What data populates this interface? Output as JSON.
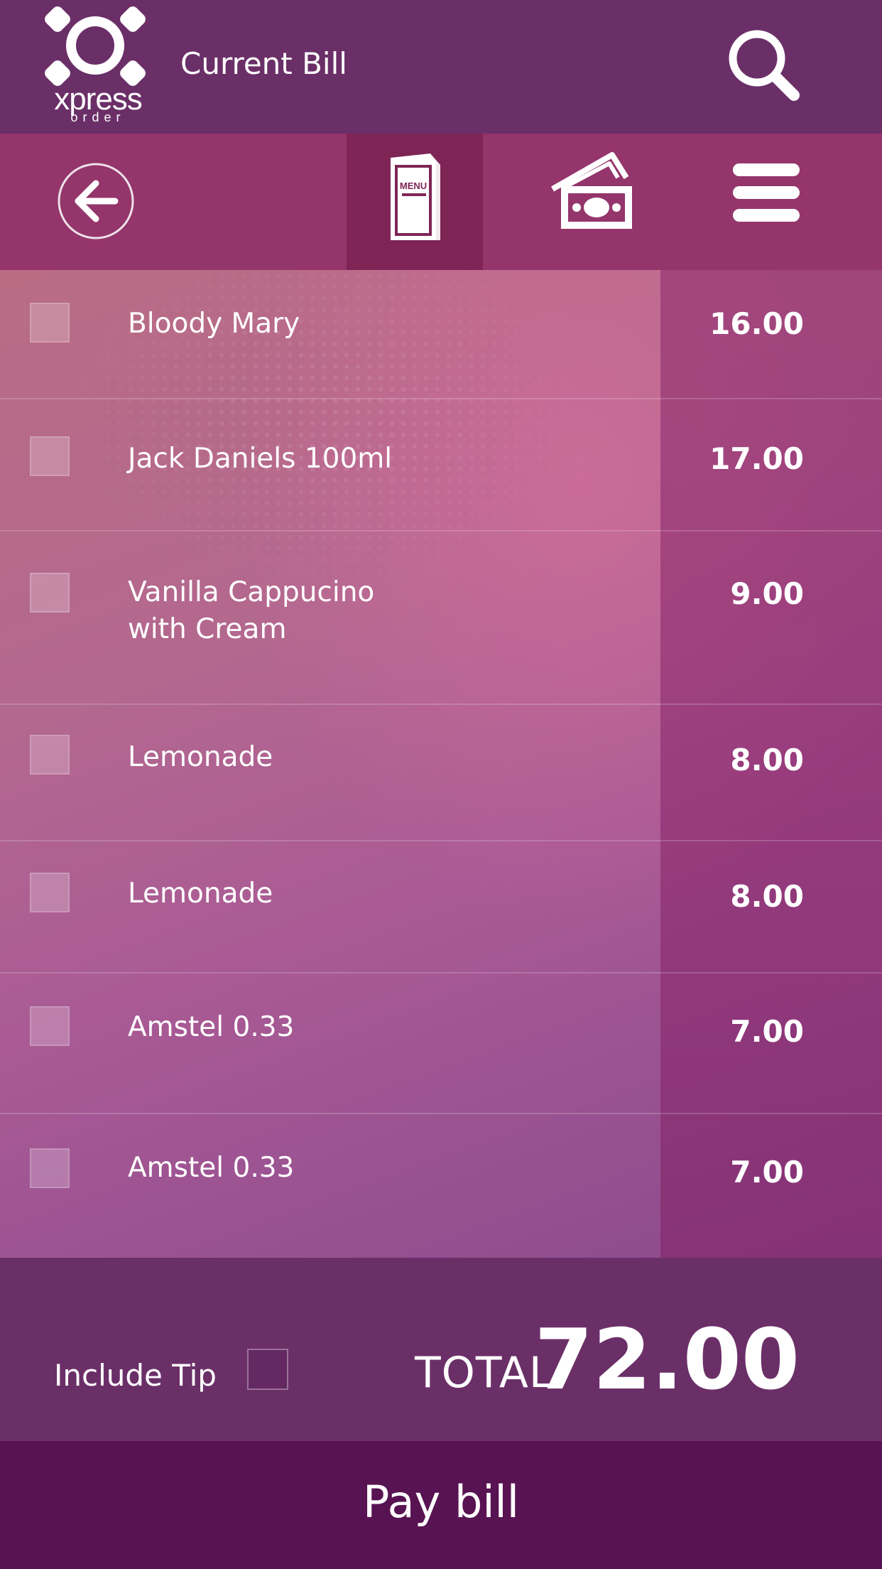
{
  "header": {
    "logo_word": "xpress",
    "logo_sub": "order",
    "title": "Current Bill",
    "search_icon": "search-icon"
  },
  "toolbar": {
    "back_icon": "back-arrow-icon",
    "menu_icon": "menu-card-icon",
    "menu_icon_text": "MENU",
    "money_icon": "cash-icon",
    "hamburger_icon": "hamburger-icon",
    "active_tab": "menu"
  },
  "items": [
    {
      "name": "Bloody Mary",
      "price": "16.00"
    },
    {
      "name": "Jack Daniels 100ml",
      "price": "17.00"
    },
    {
      "name": "Vanilla Cappucino\nwith Cream",
      "price": "9.00"
    },
    {
      "name": "Lemonade",
      "price": "8.00"
    },
    {
      "name": "Lemonade",
      "price": "8.00"
    },
    {
      "name": "Amstel 0.33",
      "price": "7.00"
    },
    {
      "name": "Amstel 0.33",
      "price": "7.00"
    }
  ],
  "footer": {
    "tip_label": "Include Tip",
    "tip_checked": false,
    "total_label": "TOTAL",
    "total_value": "72.00"
  },
  "pay_button": "Pay bill",
  "colors": {
    "header_bg": "#6b2f68",
    "toolbar_bg": "#94356b",
    "toolbar_active_bg": "#7e2556",
    "pay_bg": "#581352"
  }
}
